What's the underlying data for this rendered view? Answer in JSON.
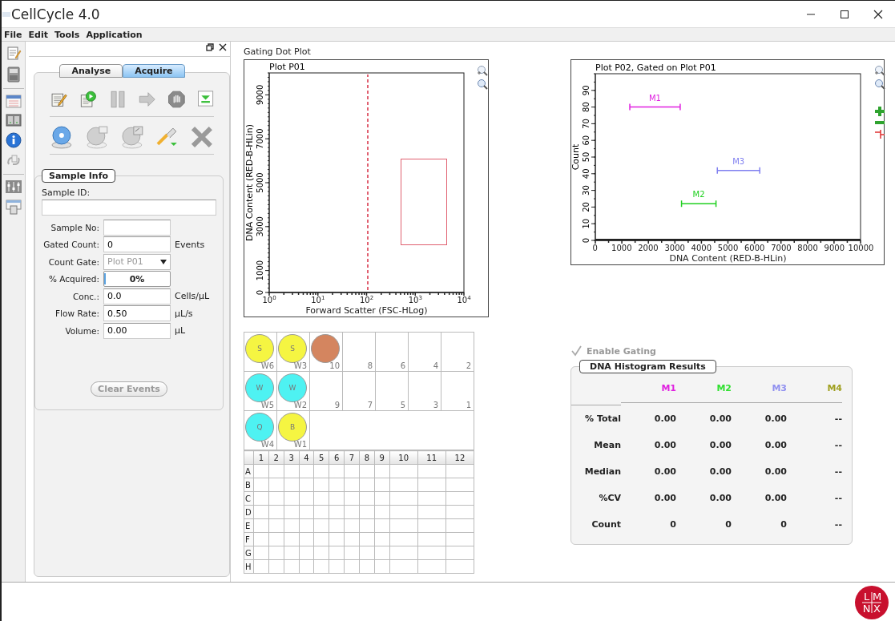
{
  "window": {
    "title": "CellCycle 4.0"
  },
  "menu": [
    "File",
    "Edit",
    "Tools",
    "Application"
  ],
  "left_panel": {
    "tabs": [
      {
        "label": "Analyse",
        "selected": false
      },
      {
        "label": "Acquire",
        "selected": true
      }
    ],
    "sample_info": {
      "title": "Sample Info",
      "sample_id": {
        "label": "Sample ID:"
      },
      "fields": [
        {
          "kind": "text",
          "label": "Sample No:"
        },
        {
          "kind": "text",
          "label": "Gated Count:",
          "value": "0",
          "unit": "Events"
        },
        {
          "kind": "dropdown",
          "label": "Count Gate:",
          "value": "Plot P01",
          "disabled": true
        },
        {
          "kind": "progress",
          "label": "% Acquired:",
          "value": "0%",
          "level": 0
        },
        {
          "kind": "text",
          "label": "Conc.:",
          "value": "0.0",
          "unit": "Cells/µL"
        },
        {
          "kind": "text",
          "label": "Flow Rate:",
          "value": "0.50",
          "unit": "µL/s"
        },
        {
          "kind": "text",
          "label": "Volume:",
          "value": "0.00",
          "unit": "µL"
        }
      ],
      "clear_button": {
        "label": "Clear Events",
        "disabled": true
      }
    }
  },
  "gating_plot": {
    "heading": "Gating Dot Plot",
    "threshold": {
      "color": "#e06070"
    },
    "gate": {
      "color": "#e06070"
    },
    "chart_data": {
      "type": "scatter",
      "title": "Plot P01",
      "xlabel": "Forward Scatter (FSC-HLog)",
      "ylabel": "DNA Content (RED-B-HLin)",
      "categories": [
        "10$^{0}$",
        "10$^{1}$",
        "10$^{2}$",
        "10$^{3}$",
        "10$^{4}$"
      ],
      "ylim": [
        0,
        10000
      ],
      "yticks": [
        0,
        1000,
        3000,
        5000,
        7000,
        9000
      ]
    }
  },
  "histogram_plot": {
    "chart_data": {
      "type": "line",
      "title": "Plot P02, Gated on Plot P01",
      "xlabel": "DNA Content (RED-B-HLin)",
      "ylabel": "Count",
      "xlim": [
        0,
        10000
      ],
      "ylim": [
        0,
        100
      ],
      "xticks": [
        0,
        1000,
        2000,
        3000,
        4000,
        5000,
        6000,
        7000,
        8000,
        9000,
        10000
      ],
      "yticks": [
        0,
        10,
        20,
        30,
        40,
        50,
        60,
        70,
        80,
        90
      ]
    },
    "markers": [
      {
        "label": "M1",
        "color": "#e020e0"
      },
      {
        "label": "M2",
        "color": "#20d020"
      },
      {
        "label": "M3",
        "color": "#8080f0"
      }
    ]
  },
  "carousel": {
    "rows": [
      [
        {
          "label": "W6",
          "tube": "S",
          "color": "#f5f542"
        },
        {
          "label": "W3",
          "tube": "S",
          "color": "#f5f542"
        },
        {
          "label": "10",
          "color": "#d4855f"
        },
        {
          "label": "8"
        },
        {
          "label": "6"
        },
        {
          "label": "4"
        },
        {
          "label": "2"
        }
      ],
      [
        {
          "label": "W5",
          "tube": "W",
          "color": "#4ef2f2"
        },
        {
          "label": "W2",
          "tube": "W",
          "color": "#4ef2f2"
        },
        {
          "label": "9"
        },
        {
          "label": "7"
        },
        {
          "label": "5"
        },
        {
          "label": "3"
        },
        {
          "label": "1"
        }
      ],
      [
        {
          "label": "W4",
          "tube": "Q",
          "color": "#4ef2f2"
        },
        {
          "label": "W1",
          "tube": "B",
          "color": "#f5f542"
        }
      ]
    ]
  },
  "plate": {
    "columns": [
      "1",
      "2",
      "3",
      "4",
      "5",
      "6",
      "7",
      "8",
      "9",
      "10",
      "11",
      "12"
    ],
    "rows": [
      "A",
      "B",
      "C",
      "D",
      "E",
      "F",
      "G",
      "H"
    ]
  },
  "enable_gating": {
    "label": "Enable Gating",
    "checked": true,
    "disabled": true
  },
  "results": {
    "title": "DNA Histogram Results",
    "columns": [
      {
        "label": "M1",
        "color": "#e020e0"
      },
      {
        "label": "M2",
        "color": "#30e030"
      },
      {
        "label": "M3",
        "color": "#9090f0"
      },
      {
        "label": "M4",
        "color": "#a0a020"
      }
    ],
    "rows": [
      {
        "label": "% Total",
        "values": [
          "0.00",
          "0.00",
          "0.00",
          "--"
        ]
      },
      {
        "label": "Mean",
        "values": [
          "0.00",
          "0.00",
          "0.00",
          "--"
        ]
      },
      {
        "label": "Median",
        "values": [
          "0.00",
          "0.00",
          "0.00",
          "--"
        ]
      },
      {
        "label": "%CV",
        "values": [
          "0.00",
          "0.00",
          "0.00",
          "--"
        ]
      },
      {
        "label": "Count",
        "values": [
          "0",
          "0",
          "0",
          "--"
        ]
      }
    ]
  },
  "logo": [
    "L",
    "M",
    "N",
    "X"
  ]
}
